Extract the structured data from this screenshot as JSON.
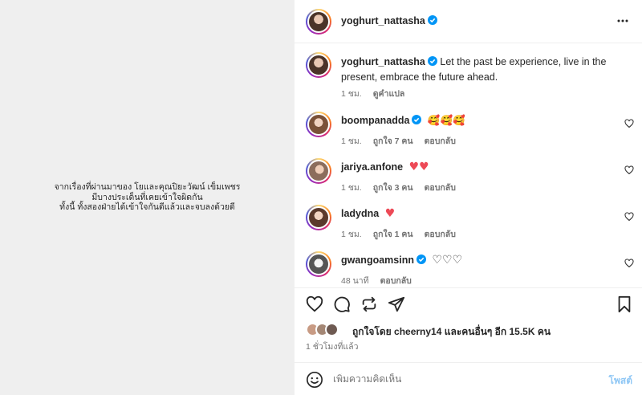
{
  "media": {
    "lines": [
      "จากเรื่องที่ผ่านมาของ โยและคุณปิยะวัฒน์ เข็มเพชร",
      "มีบางประเด็นที่เคยเข้าใจผิดกัน",
      "ทั้งนี้ ทั้งสองฝ่ายได้เข้าใจกันดีแล้วและจบลงด้วยดี"
    ]
  },
  "header": {
    "username": "yoghurt_nattasha"
  },
  "caption": {
    "username": "yoghurt_nattasha",
    "text": "Let the past be experience, live in the present, embrace the future ahead.",
    "time": "1 ชม.",
    "translate": "ดูคำแปล"
  },
  "comments": [
    {
      "username": "boompanadda",
      "text": "🥰🥰🥰",
      "time": "1 ชม.",
      "likes": "ถูกใจ 7 คน",
      "reply": "ตอบกลับ",
      "verified": true
    },
    {
      "username": "jariya.anfone",
      "text": "♥♥",
      "time": "1 ชม.",
      "likes": "ถูกใจ 3 คน",
      "reply": "ตอบกลับ",
      "verified": false
    },
    {
      "username": "ladydna",
      "text": "♥",
      "time": "1 ชม.",
      "likes": "ถูกใจ 1 คน",
      "reply": "ตอบกลับ",
      "verified": false
    },
    {
      "username": "gwangoamsinn",
      "text": "♡♡♡",
      "time": "48 นาที",
      "likes": "",
      "reply": "ตอบกลับ",
      "verified": true
    }
  ],
  "likes": {
    "text": "ถูกใจโดย cheerny14 และคนอื่นๆ อีก 15.5K คน"
  },
  "posted": "1 ชั่วโมงที่แล้ว",
  "comment_box": {
    "placeholder": "เพิ่มความคิดเห็น",
    "post": "โพสต์"
  },
  "colors": {
    "verified": "#0095f6",
    "heart": "#ed4956",
    "post_disabled": "#8fc7f5"
  },
  "icons": [
    "verified-icon",
    "more-icon",
    "heart-icon",
    "comment-icon",
    "share-icon",
    "send-icon",
    "save-icon",
    "emoji-icon"
  ]
}
